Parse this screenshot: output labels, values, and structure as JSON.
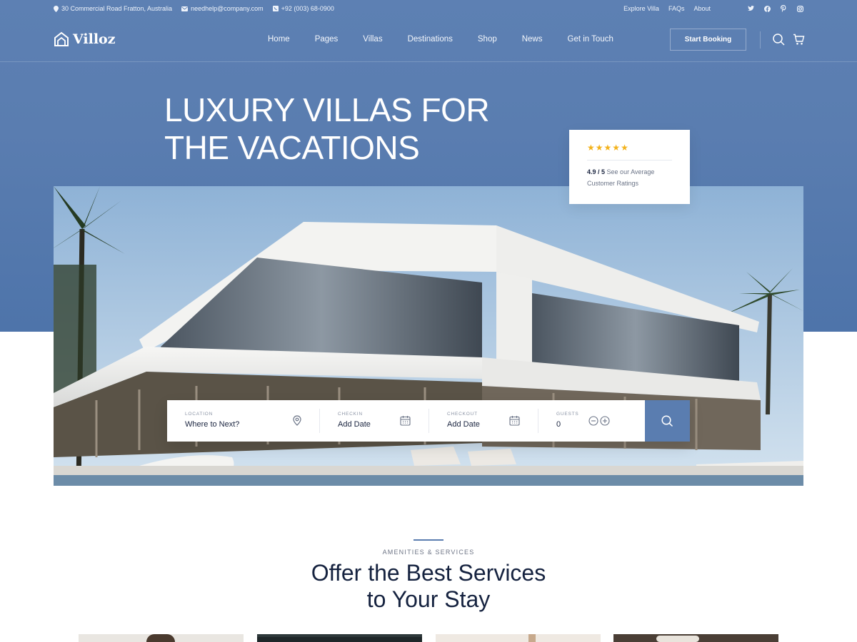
{
  "topbar": {
    "address": "30 Commercial Road Fratton, Australia",
    "email": "needhelp@company.com",
    "phone": "+92 (003) 68-0900",
    "links": [
      "Explore Villa",
      "FAQs",
      "About"
    ],
    "social_icons": [
      "twitter-icon",
      "facebook-icon",
      "pinterest-icon",
      "instagram-icon"
    ]
  },
  "header": {
    "logo_text": "Villoz",
    "nav": [
      "Home",
      "Pages",
      "Villas",
      "Destinations",
      "Shop",
      "News",
      "Get in Touch"
    ],
    "cta_label": "Start Booking"
  },
  "hero": {
    "title_line1": "LUXURY VILLAS FOR",
    "title_line2": "THE VACATIONS",
    "rating": {
      "stars": 5,
      "score": "4.9 / 5",
      "text_part1": "See our Average",
      "text_part2": "Customer Ratings"
    }
  },
  "search": {
    "location_label": "LOCATION",
    "location_value": "Where to Next?",
    "checkin_label": "CHECKIN",
    "checkin_value": "Add Date",
    "checkout_label": "CHECKOUT",
    "checkout_value": "Add Date",
    "guests_label": "GUESTS",
    "guests_value": "0"
  },
  "amenities": {
    "tag": "AMENITIES & SERVICES",
    "title_line1": "Offer the Best Services",
    "title_line2": "to Your Stay"
  },
  "colors": {
    "brand_blue": "#5a7db0",
    "star": "#f3b21b",
    "heading": "#15223f"
  }
}
